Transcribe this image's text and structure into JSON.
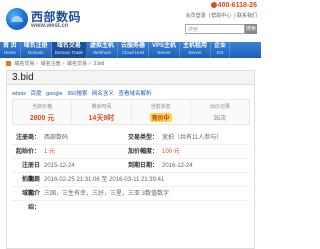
{
  "header": {
    "logo_text": "西部数码",
    "logo_url": "www.west.cn",
    "phone": "400-6118-26",
    "toplinks": [
      "会员登录",
      "| 帮助中心",
      "| 联系我们"
    ],
    "search_placeholder": "搜索",
    "search_button": "搜索"
  },
  "nav": [
    {
      "label": "首 页",
      "sub": "Home"
    },
    {
      "label": "域名注册",
      "sub": "Domain"
    },
    {
      "label": "域名交易",
      "sub": "Domain Trade"
    },
    {
      "label": "虚拟主机",
      "sub": "Webhost"
    },
    {
      "label": "云服务器",
      "sub": "Cloud Host"
    },
    {
      "label": "VPS主机",
      "sub": "Server"
    },
    {
      "label": "主机租用",
      "sub": "Server"
    },
    {
      "label": "企业",
      "sub": "Ent"
    }
  ],
  "breadcrumb": [
    "域名交易",
    "域名注册",
    "域名交易",
    "3.bid"
  ],
  "domain": {
    "name": "3.bid",
    "links": [
      "whois",
      "百度",
      "google",
      "360搜索",
      "网名含义",
      "查看域名解析"
    ],
    "stats": [
      {
        "label": "当前价格",
        "value": "2800 元"
      },
      {
        "label": "剩余时间",
        "value": "14天9时"
      },
      {
        "label": "当前状态",
        "value": "竞价中"
      },
      {
        "label": "出价记录",
        "value": "35次"
      }
    ],
    "rows": [
      {
        "k1": "注册商：",
        "v1": "西部数码",
        "k2": "交易类型：",
        "v2": "竞拍（共有11人参与）"
      },
      {
        "k1": "起始价：",
        "v1": "1 元",
        "k2": "加价幅度：",
        "v2": "100 元"
      },
      {
        "k1": "注册日期：",
        "v1": "2015-12-24",
        "k2": "到期日期：",
        "v2": "2016-12-24"
      },
      {
        "k1": "拍卖周期：",
        "v1": "2016-02-25 21:31:06 至 2016-03-11 21:39:41",
        "k2": "",
        "v2": ""
      },
      {
        "k1": "域名介绍：",
        "v1": "三国，三生有幸，三好，三星，三亚 3数值数字",
        "k2": "",
        "v2": ""
      }
    ]
  }
}
